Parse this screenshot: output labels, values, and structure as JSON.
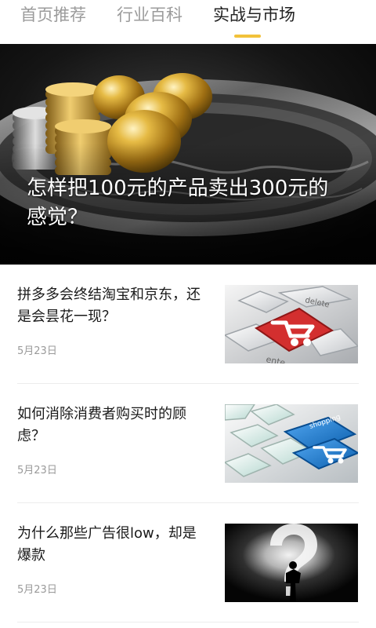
{
  "tabs": [
    {
      "label": "首页推荐",
      "active": false
    },
    {
      "label": "行业百科",
      "active": false
    },
    {
      "label": "实战与市场",
      "active": true
    }
  ],
  "colors": {
    "accent": "#f2c23a",
    "title_text": "#1a1a1a",
    "muted_text": "#9a9a9a",
    "cart_red": "#d32f2f",
    "shopping_blue": "#1f7fd1"
  },
  "hero": {
    "title": "怎样把100元的产品卖出300元的感觉？",
    "image_icon": "gold-eggs-coins-image"
  },
  "articles": [
    {
      "title": "拼多多会终结淘宝和京东，还是会昙花一现？",
      "date": "5月23日",
      "image_icon": "keyboard-cart-image",
      "image_text": [
        "delete",
        "ente"
      ]
    },
    {
      "title": "如何消除消费者购买时的顾虑？",
      "date": "5月23日",
      "image_icon": "keyboard-shopping-image",
      "image_text": [
        "shopping"
      ]
    },
    {
      "title": "为什么那些广告很low，却是爆款",
      "date": "5月23日",
      "image_icon": "question-mark-figure-image"
    }
  ]
}
